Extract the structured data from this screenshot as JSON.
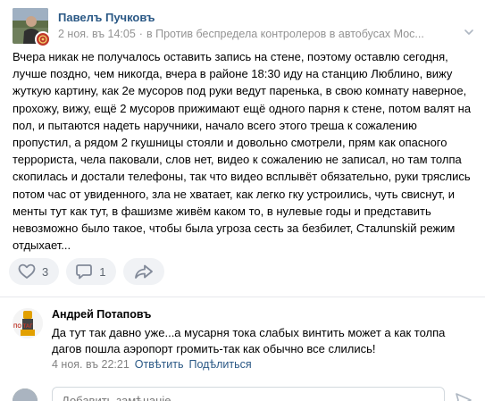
{
  "post": {
    "author": "Павелъ Пучковъ",
    "date": "2 ноя. въ 14:05",
    "separator": "·",
    "source": "в Против беспредела контролеров в автобусах Мос...",
    "text": "Вчера никак не получалось оставить запись на стене, поэтому оставлю сегодня, лучше поздно, чем никогда, вчера в районе 18:30 иду на станцию Люблино, вижу жуткую картину, как 2е мусоров под руки ведут паренька, в свою комнату наверное, прохожу, вижу, ещё 2 мусоров прижимают ещё одного парня к стене, потом валят на пол, и пытаются надеть наручники, начало всего этого треша к сожалению пропустил, а рядом 2 гкушницы стояли и довольно смотрели, прям как опасного террориста, чела паковали, слов нет, видео к сожалению не записал, но там толпа скопилась и достали телефоны, так что видео всплывёт обязательно, руки тряслись потом час от увиденного, зла не хватает, как легко гку устроились, чуть свиснут, и менты тут как тут, в фашизме живём каком то, в нулевые годы и представить невозможно было такое, чтобы была угроза сесть за безбилет, Сталunskій режим отдыхает..."
  },
  "actions": {
    "likes": "3",
    "comments": "1"
  },
  "comment": {
    "author": "Андрей Потаповъ",
    "text": "Да тут так давно уже...а мусарня тока слабых винтить может а как толпа дагов пошла аэропорт громить-так как обычно все слились!",
    "date": "4 ноя. въ 22:21",
    "reply_label": "Отвѣтить",
    "share_label": "Подѣлиться",
    "avatar_text": "ПО ТАГ"
  },
  "reply": {
    "placeholder": "Добавить замѣчаніе..."
  },
  "colors": {
    "link": "#2a5885",
    "meta": "#939393",
    "action_bg": "#f0f2f5",
    "action_icon": "#828a99"
  },
  "icons": {
    "like": "heart-icon",
    "comment": "speech-bubble-icon",
    "share": "share-arrow-icon",
    "menu": "chevron-down-icon",
    "send": "send-arrow-icon"
  }
}
